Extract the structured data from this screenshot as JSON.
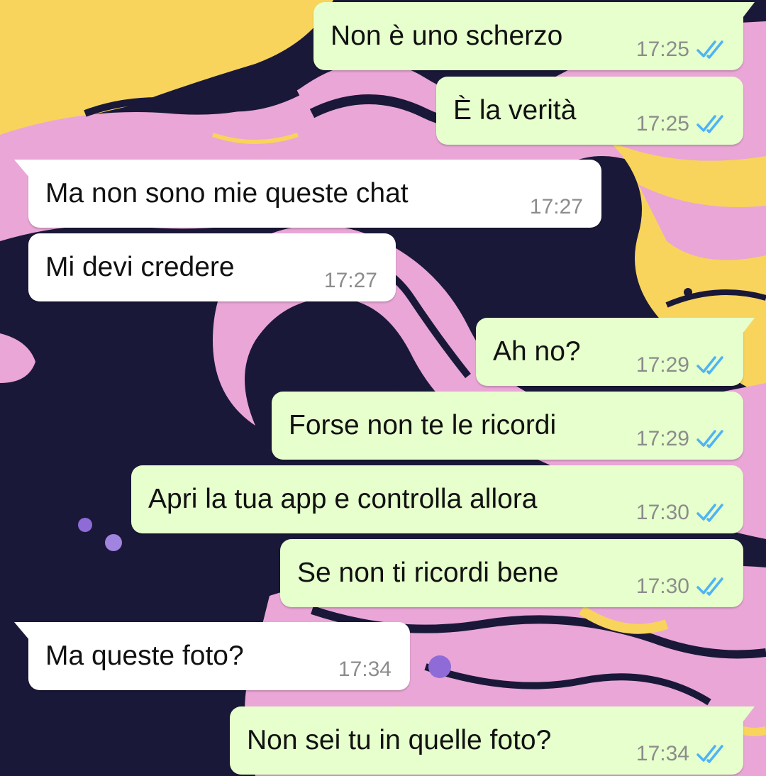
{
  "colors": {
    "outgoing_bubble": "#e6ffcc",
    "incoming_bubble": "#ffffff",
    "read_ticks": "#4fb3f4",
    "timestamp": "#8c8c8c",
    "wallpaper_pink": "#e9a6d6",
    "wallpaper_navy": "#1a1838",
    "wallpaper_yellow": "#f8d45c"
  },
  "icons": {
    "read_receipt": "double-check-icon"
  },
  "messages": [
    {
      "direction": "out",
      "text": "Non è uno scherzo",
      "time": "17:25",
      "status": "read"
    },
    {
      "direction": "out",
      "text": "È la verità",
      "time": "17:25",
      "status": "read"
    },
    {
      "direction": "in",
      "text": "Ma non sono mie queste chat",
      "time": "17:27"
    },
    {
      "direction": "in",
      "text": "Mi devi credere",
      "time": "17:27"
    },
    {
      "direction": "out",
      "text": "Ah no?",
      "time": "17:29",
      "status": "read"
    },
    {
      "direction": "out",
      "text": "Forse non te le ricordi",
      "time": "17:29",
      "status": "read"
    },
    {
      "direction": "out",
      "text": "Apri la tua app e controlla allora",
      "time": "17:30",
      "status": "read"
    },
    {
      "direction": "out",
      "text": "Se non ti ricordi bene",
      "time": "17:30",
      "status": "read"
    },
    {
      "direction": "in",
      "text": "Ma queste foto?",
      "time": "17:34"
    },
    {
      "direction": "out",
      "text": "Non sei tu in quelle foto?",
      "time": "17:34",
      "status": "read"
    }
  ]
}
